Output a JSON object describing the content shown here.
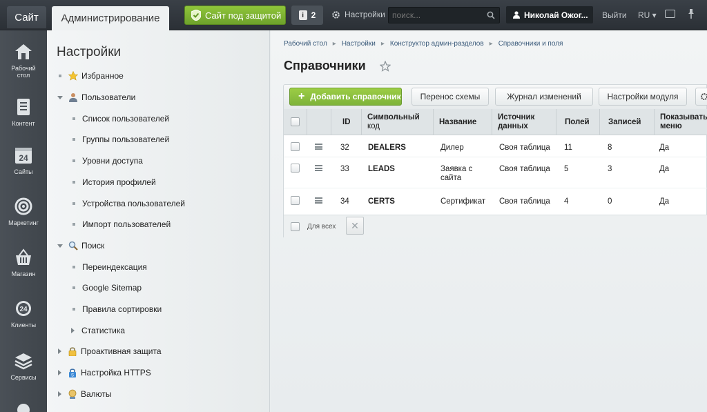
{
  "topbar": {
    "site_tab": "Сайт",
    "admin_tab": "Администрирование",
    "protect_label": "Сайт под защитой",
    "notifications_count": "2",
    "settings_label": "Настройки",
    "search_placeholder": "поиск...",
    "user_name": "Николай Ожог...",
    "logout_label": "Выйти",
    "lang_label": "RU"
  },
  "leftnav": {
    "items": [
      {
        "label1": "Рабочий",
        "label2": "стол",
        "icon": "home-icon"
      },
      {
        "label1": "Контент",
        "label2": "",
        "icon": "document-icon"
      },
      {
        "label1": "Сайты",
        "label2": "",
        "icon": "calendar-24-icon"
      },
      {
        "label1": "Маркетинг",
        "label2": "",
        "icon": "target-icon"
      },
      {
        "label1": "Магазин",
        "label2": "",
        "icon": "basket-icon"
      },
      {
        "label1": "Клиенты",
        "label2": "",
        "icon": "clients-24-icon"
      },
      {
        "label1": "Сервисы",
        "label2": "",
        "icon": "layers-icon"
      }
    ],
    "cloud_icon": "cloud-icon"
  },
  "tree": {
    "title": "Настройки",
    "items": [
      {
        "label": "Избранное"
      },
      {
        "label": "Пользователи"
      },
      {
        "label": "Список пользователей"
      },
      {
        "label": "Группы пользователей"
      },
      {
        "label": "Уровни доступа"
      },
      {
        "label": "История профилей"
      },
      {
        "label": "Устройства пользователей"
      },
      {
        "label": "Импорт пользователей"
      },
      {
        "label": "Поиск"
      },
      {
        "label": "Переиндексация"
      },
      {
        "label": "Google Sitemap"
      },
      {
        "label": "Правила сортировки"
      },
      {
        "label": "Статистика"
      },
      {
        "label": "Проактивная защита"
      },
      {
        "label": "Настройка HTTPS"
      },
      {
        "label": "Валюты"
      }
    ]
  },
  "breadcrumb": [
    "Рабочий стол",
    "Настройки",
    "Конструктор админ-разделов",
    "Справочники и поля"
  ],
  "page_title": "Справочники",
  "toolbar": {
    "add_label": "Добавить справочник",
    "transfer_label": "Перенос схемы",
    "log_label": "Журнал изменений",
    "module_settings_label": "Настройки модуля"
  },
  "grid": {
    "headers": {
      "id": "ID",
      "code1": "Символьный",
      "code2": "код",
      "name": "Название",
      "source1": "Источник",
      "source2": "данных",
      "fields": "Полей",
      "records": "Записей",
      "menu1": "Показывать",
      "menu2": "меню"
    },
    "rows": [
      {
        "id": "32",
        "code": "DEALERS",
        "name1": "Дилер",
        "name2": "",
        "source": "Своя таблица",
        "fields": "11",
        "records": "8",
        "menu": "Да"
      },
      {
        "id": "33",
        "code": "LEADS",
        "name1": "Заявка с",
        "name2": "сайта",
        "source": "Своя таблица",
        "fields": "5",
        "records": "3",
        "menu": "Да"
      },
      {
        "id": "34",
        "code": "CERTS",
        "name1": "Сертификат",
        "name2": "",
        "source": "Своя таблица",
        "fields": "4",
        "records": "0",
        "menu": "Да"
      }
    ],
    "footer_all": "Для всех"
  },
  "colors": {
    "accent_green": "#7eb33a",
    "topbar": "#2b3036",
    "link": "#3a5a7a"
  }
}
